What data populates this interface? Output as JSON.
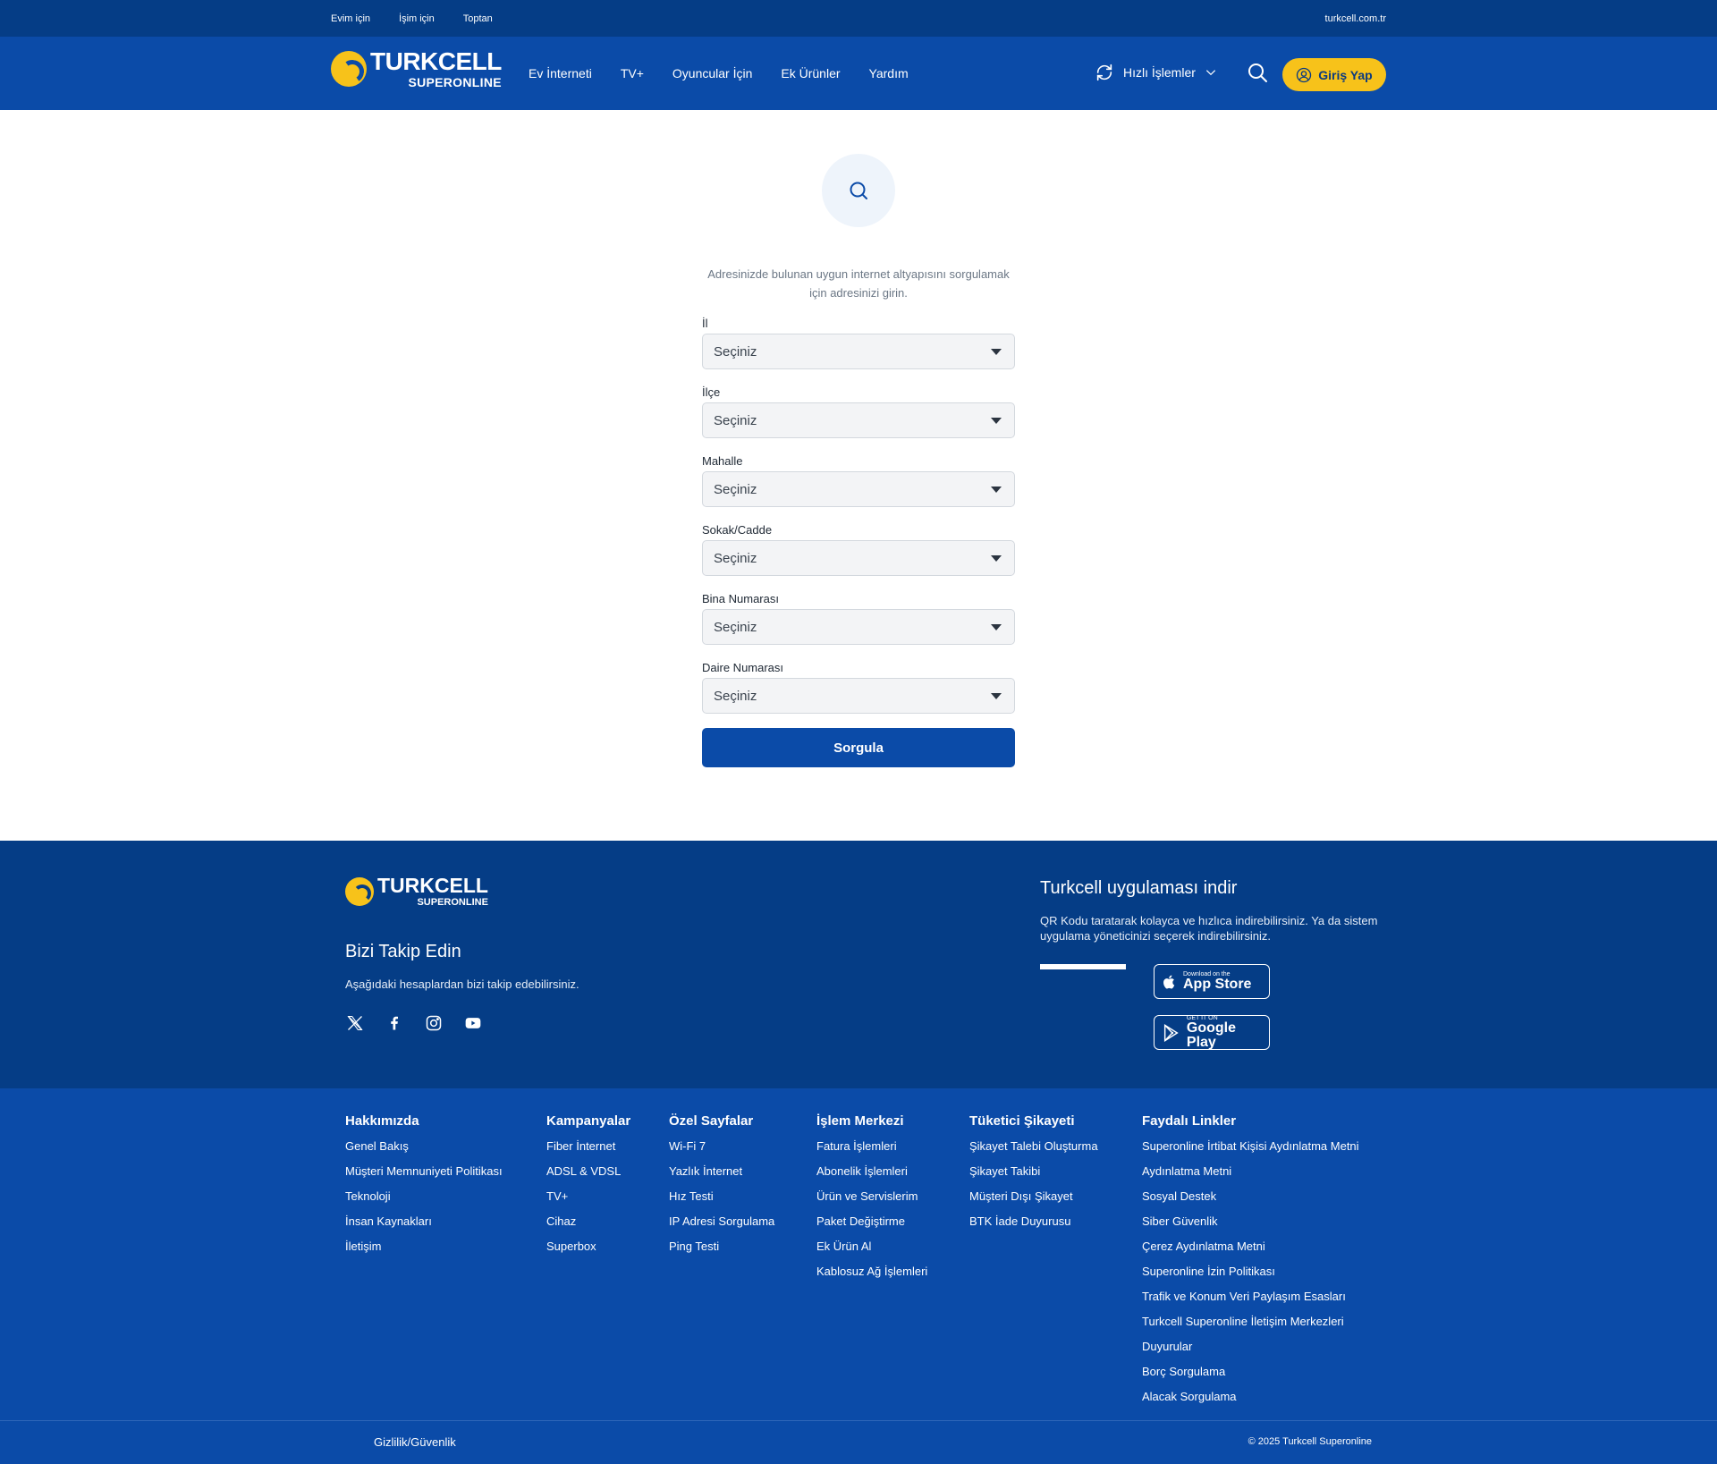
{
  "topbar": {
    "links": [
      "Evim için",
      "İşim için",
      "Toptan"
    ],
    "site": "turkcell.com.tr"
  },
  "header": {
    "logo_main": "TURKCELL",
    "logo_sub": "SUPERONLINE",
    "nav": [
      "Ev İnterneti",
      "TV+",
      "Oyuncular İçin",
      "Ek Ürünler",
      "Yardım"
    ],
    "quick_label": "Hızlı İşlemler",
    "login_label": "Giriş Yap"
  },
  "main": {
    "intro": "Adresinizde bulunan uygun internet altyapısını sorgulamak için adresinizi girin.",
    "fields": [
      {
        "label": "İl",
        "value": "Seçiniz"
      },
      {
        "label": "İlçe",
        "value": "Seçiniz"
      },
      {
        "label": "Mahalle",
        "value": "Seçiniz"
      },
      {
        "label": "Sokak/Cadde",
        "value": "Seçiniz"
      },
      {
        "label": "Bina Numarası",
        "value": "Seçiniz"
      },
      {
        "label": "Daire Numarası",
        "value": "Seçiniz"
      }
    ],
    "submit_label": "Sorgula"
  },
  "footer": {
    "logo_main": "TURKCELL",
    "logo_sub": "SUPERONLINE",
    "follow_title": "Bizi Takip Edin",
    "follow_desc": "Aşağıdaki hesaplardan bizi takip edebilirsiniz.",
    "social_icons": [
      "x-icon",
      "facebook-icon",
      "instagram-icon",
      "youtube-icon"
    ],
    "app_title": "Turkcell uygulaması indir",
    "app_desc": "QR Kodu taratarak kolayca ve hızlıca indirebilirsiniz. Ya da sistem uygulama yöneticinizi seçerek indirebilirsiniz.",
    "appstore_small": "Download on the",
    "appstore_big": "App Store",
    "googleplay_small": "GET IT ON",
    "googleplay_big": "Google Play",
    "columns": [
      {
        "title": "Hakkımızda",
        "items": [
          "Genel Bakış",
          "Müşteri Memnuniyeti Politikası",
          "Teknoloji",
          "İnsan Kaynakları",
          "İletişim"
        ]
      },
      {
        "title": "Kampanyalar",
        "items": [
          "Fiber İnternet",
          "ADSL & VDSL",
          "TV+",
          "Cihaz",
          "Superbox"
        ]
      },
      {
        "title": "Özel Sayfalar",
        "items": [
          "Wi-Fi 7",
          "Yazlık İnternet",
          "Hız Testi",
          "IP Adresi Sorgulama",
          "Ping Testi"
        ]
      },
      {
        "title": "İşlem Merkezi",
        "items": [
          "Fatura İşlemleri",
          "Abonelik İşlemleri",
          "Ürün ve Servislerim",
          "Paket Değiştirme",
          "Ek Ürün Al",
          "Kablosuz Ağ İşlemleri"
        ]
      },
      {
        "title": "Tüketici Şikayeti",
        "items": [
          "Şikayet Talebi Oluşturma",
          "Şikayet Takibi",
          "Müşteri Dışı Şikayet",
          "BTK İade Duyurusu"
        ]
      },
      {
        "title": "Faydalı Linkler",
        "items": [
          "Superonline İrtibat Kişisi Aydınlatma Metni",
          "Aydınlatma Metni",
          "Sosyal Destek",
          "Siber Güvenlik",
          "Çerez Aydınlatma Metni",
          "Superonline İzin Politikası",
          "Trafik ve Konum Veri Paylaşım Esasları",
          "Turkcell Superonline İletişim Merkezleri",
          "Duyurular",
          "Borç Sorgulama",
          "Alacak Sorgulama"
        ]
      }
    ],
    "privacy": "Gizlilik/Güvenlik",
    "copyright": "© 2025 Turkcell Superonline"
  },
  "colors": {
    "primary": "#0b4ba8",
    "dark": "#053d86",
    "accent": "#f7c21a"
  }
}
